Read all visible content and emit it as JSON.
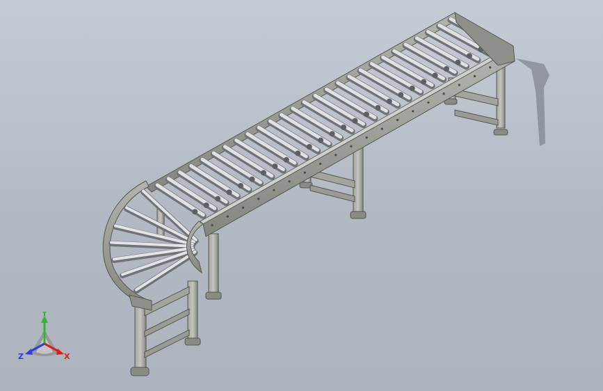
{
  "view": {
    "background_top": "#c6ccd4",
    "background_bottom": "#aeb4bd",
    "model": "roller-conveyor",
    "roller_color": "#c8cacd",
    "frame_color": "#9c9d96"
  },
  "triad": {
    "x_label": "X",
    "y_label": "Y",
    "z_label": "Z",
    "x_color": "#d42020",
    "y_color": "#2fb72f",
    "z_color": "#2c3fd8"
  }
}
